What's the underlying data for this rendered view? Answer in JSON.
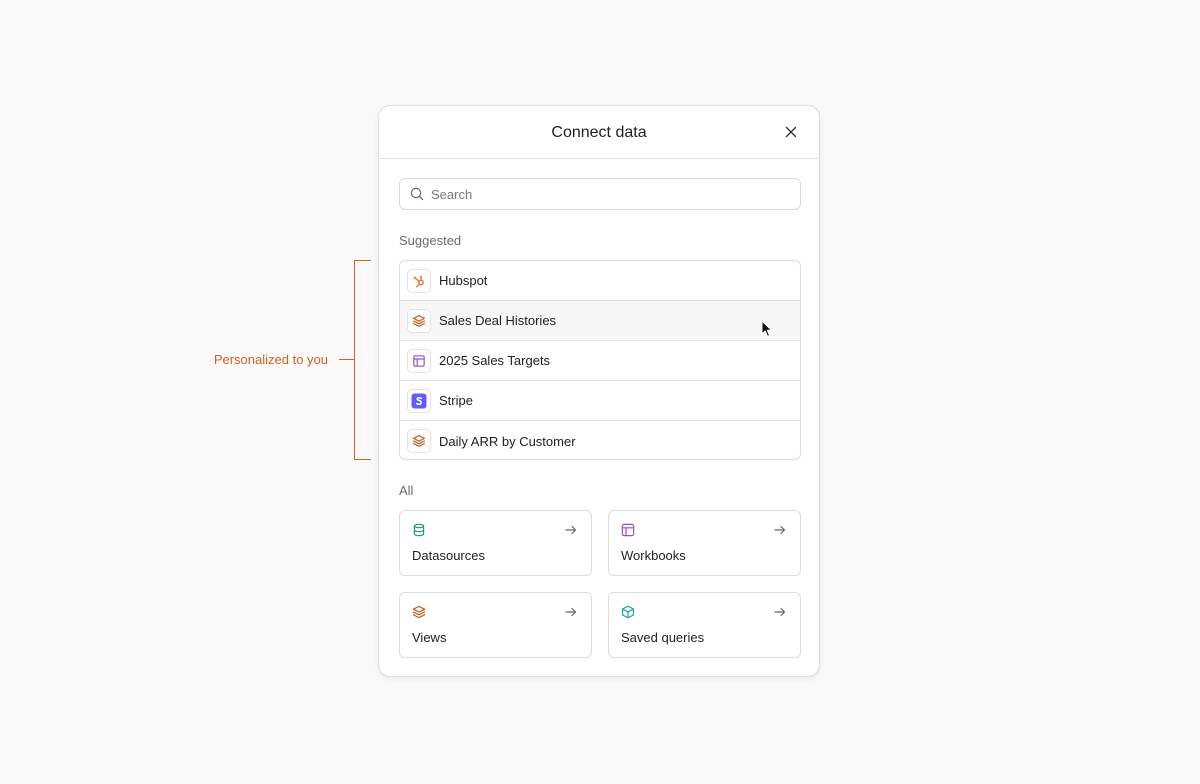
{
  "annotation": {
    "label": "Personalized to you"
  },
  "dialog": {
    "title": "Connect data"
  },
  "search": {
    "placeholder": "Search"
  },
  "suggested": {
    "label": "Suggested",
    "items": [
      {
        "label": "Hubspot",
        "icon": "hubspot-icon"
      },
      {
        "label": "Sales Deal Histories",
        "icon": "layers-icon"
      },
      {
        "label": "2025 Sales Targets",
        "icon": "workbook-icon"
      },
      {
        "label": "Stripe",
        "icon": "stripe-icon"
      },
      {
        "label": "Daily ARR by Customer",
        "icon": "layers-icon"
      }
    ]
  },
  "all": {
    "label": "All",
    "cards": [
      {
        "label": "Datasources",
        "icon": "database-icon"
      },
      {
        "label": "Workbooks",
        "icon": "workbook-icon"
      },
      {
        "label": "Views",
        "icon": "layers-icon"
      },
      {
        "label": "Saved queries",
        "icon": "cube-icon"
      }
    ]
  },
  "colors": {
    "accent": "#d2621f",
    "hubspot": "#f06a35",
    "layers": "#c4561d",
    "workbook": "#9b4fcf",
    "stripe": "#635bff",
    "database": "#1a9e6e",
    "cube": "#1aa3b5"
  }
}
